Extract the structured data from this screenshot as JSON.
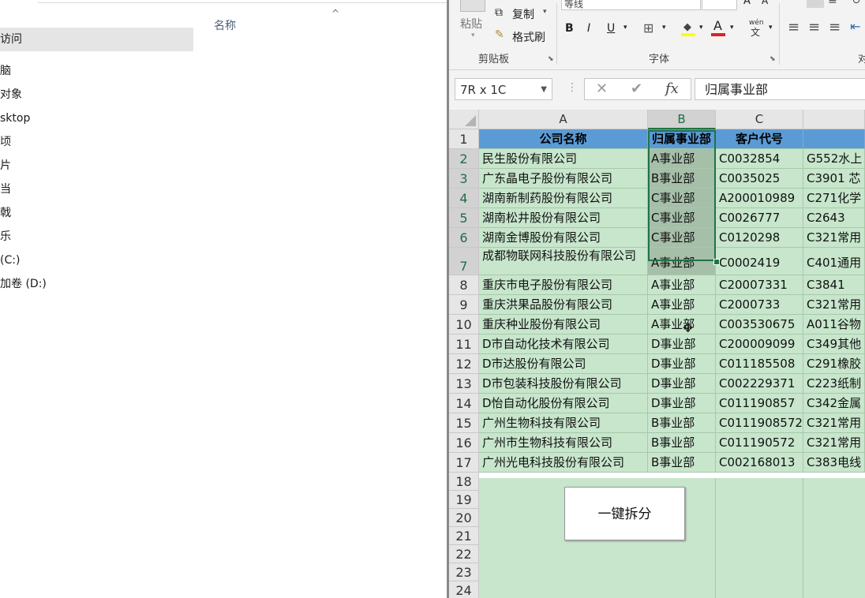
{
  "explorer": {
    "column_header": "名称",
    "nav_items": [
      {
        "label": "访问",
        "selected": true
      },
      {
        "label": "脑",
        "selected": false
      },
      {
        "label": "对象",
        "selected": false
      },
      {
        "label": "sktop",
        "selected": false
      },
      {
        "label": "顷",
        "selected": false
      },
      {
        "label": "片",
        "selected": false
      },
      {
        "label": "当",
        "selected": false
      },
      {
        "label": "戟",
        "selected": false
      },
      {
        "label": "乐",
        "selected": false
      },
      {
        "label": "(C:)",
        "selected": false
      },
      {
        "label": "加卷 (D:)",
        "selected": false
      }
    ]
  },
  "ribbon": {
    "font_name": "等线",
    "paste_label": "粘贴",
    "copy_label": "复制",
    "format_painter_label": "格式刷",
    "clipboard_group": "剪贴板",
    "font_group": "字体",
    "bold": "B",
    "italic": "I",
    "underline": "U",
    "font_color_glyph": "A",
    "grow_font": "A",
    "shrink_font": "A",
    "phonetic": "wén",
    "phonetic_char": "文",
    "next_group_partial": "对"
  },
  "formula_bar": {
    "name_box": "7R x 1C",
    "cancel_glyph": "✕",
    "enter_glyph": "✔",
    "fx": "fx",
    "formula": "归属事业部"
  },
  "sheet": {
    "columns": [
      "A",
      "B",
      "C"
    ],
    "selected_column": "B",
    "rows": [
      "1",
      "2",
      "3",
      "4",
      "5",
      "6",
      "7",
      "8",
      "9",
      "10",
      "11",
      "12",
      "13",
      "14",
      "15",
      "16",
      "17",
      "18",
      "19",
      "20",
      "21",
      "22",
      "23",
      "24"
    ],
    "header_row": [
      "公司名称",
      "归属事业部",
      "客户代号",
      ""
    ],
    "data": [
      [
        "民生股份有限公司",
        "A事业部",
        "C0032854",
        "G552水上"
      ],
      [
        "广东晶电子股份有限公司",
        "B事业部",
        "C0035025",
        "C3901 芯"
      ],
      [
        "湖南新制药股份有限公司",
        "C事业部",
        "A200010989",
        "C271化学"
      ],
      [
        "湖南松井股份有限公司",
        "C事业部",
        "C0026777",
        "C2643　"
      ],
      [
        "湖南金博股份有限公司",
        "C事业部",
        "C0120298",
        "C321常用"
      ],
      [
        "成都物联网科技股份有限公司",
        "A事业部",
        "C0002419",
        "C401通用"
      ],
      [
        "重庆市电子股份有限公司",
        "A事业部",
        "C20007331",
        "C3841　"
      ],
      [
        "重庆洪果品股份有限公司",
        "A事业部",
        "C2000733",
        "C321常用"
      ],
      [
        "重庆种业股份有限公司",
        "A事业部",
        "C003530675",
        "A011谷物"
      ],
      [
        "D市自动化技术有限公司",
        "D事业部",
        "C200009099",
        "C349其他"
      ],
      [
        "D市达股份有限公司",
        "D事业部",
        "C011185508",
        "C291橡胶"
      ],
      [
        "D市包装科技股份有限公司",
        "D事业部",
        "C002229371",
        "C223纸制"
      ],
      [
        "D怡自动化股份有限公司",
        "D事业部",
        "C011190857",
        "C342金属"
      ],
      [
        "广州生物科技有限公司",
        "B事业部",
        "C0111908572",
        "C321常用"
      ],
      [
        "广州市生物科技有限公司",
        "B事业部",
        "C011190572",
        "C321常用"
      ],
      [
        "广州光电科技股份有限公司",
        "B事业部",
        "C002168013",
        "C383电线"
      ]
    ],
    "macro_button": "一键拆分"
  },
  "colors": {
    "header_fill": "#5b9bd5",
    "body_fill": "#c7e6cc",
    "selection": "#217346"
  }
}
